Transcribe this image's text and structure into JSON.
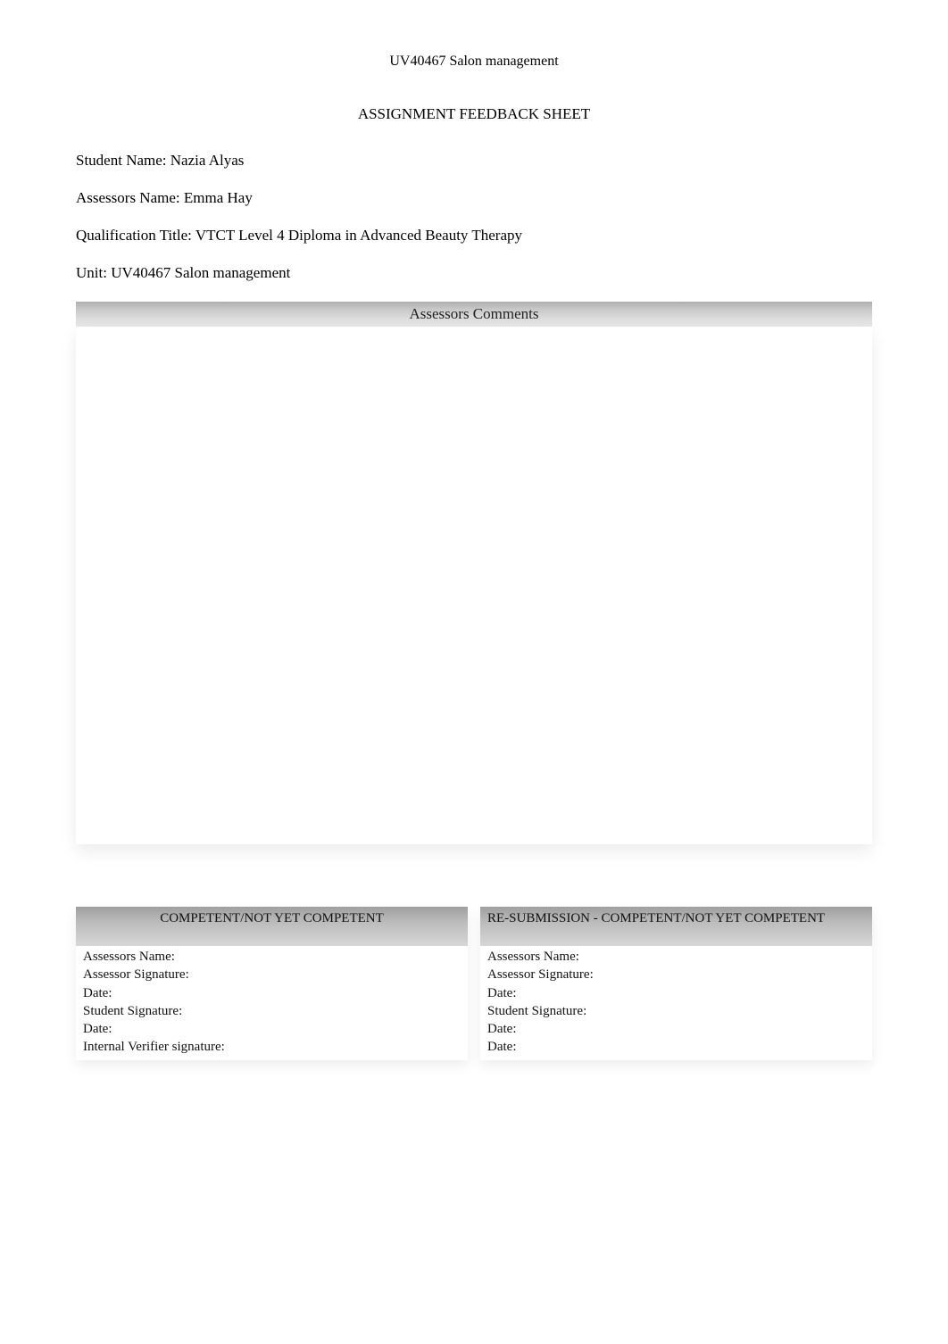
{
  "header": {
    "unit_code": "UV40467 Salon management"
  },
  "sheet_title": "ASSIGNMENT FEEDBACK SHEET",
  "meta": {
    "student_name_label": "Student Name: ",
    "student_name": "Nazia Alyas",
    "assessors_name_label": "Assessors Name: ",
    "assessors_name": "Emma Hay",
    "qualification_title_label": "Qualification Title:   ",
    "qualification_title": "VTCT Level 4 Diploma in Advanced Beauty Therapy",
    "unit_label": "Unit: ",
    "unit": "UV40467 Salon management"
  },
  "comments_header": "Assessors Comments",
  "comments_text": "",
  "box_left": {
    "header": "COMPETENT/NOT YET COMPETENT",
    "rows": {
      "assessors_name": "Assessors Name:",
      "assessor_signature": "Assessor Signature:",
      "date1": "Date:",
      "student_signature": "Student Signature:",
      "date2": "Date:",
      "iv_signature": "Internal Verifier signature:"
    }
  },
  "box_right": {
    "header": "RE-SUBMISSION - COMPETENT/NOT YET COMPETENT",
    "rows": {
      "assessors_name": "Assessors Name:",
      "assessor_signature": "Assessor Signature:",
      "date1": "Date:",
      "student_signature": "Student Signature:",
      "date2": "Date:",
      "date3": "Date:"
    }
  }
}
